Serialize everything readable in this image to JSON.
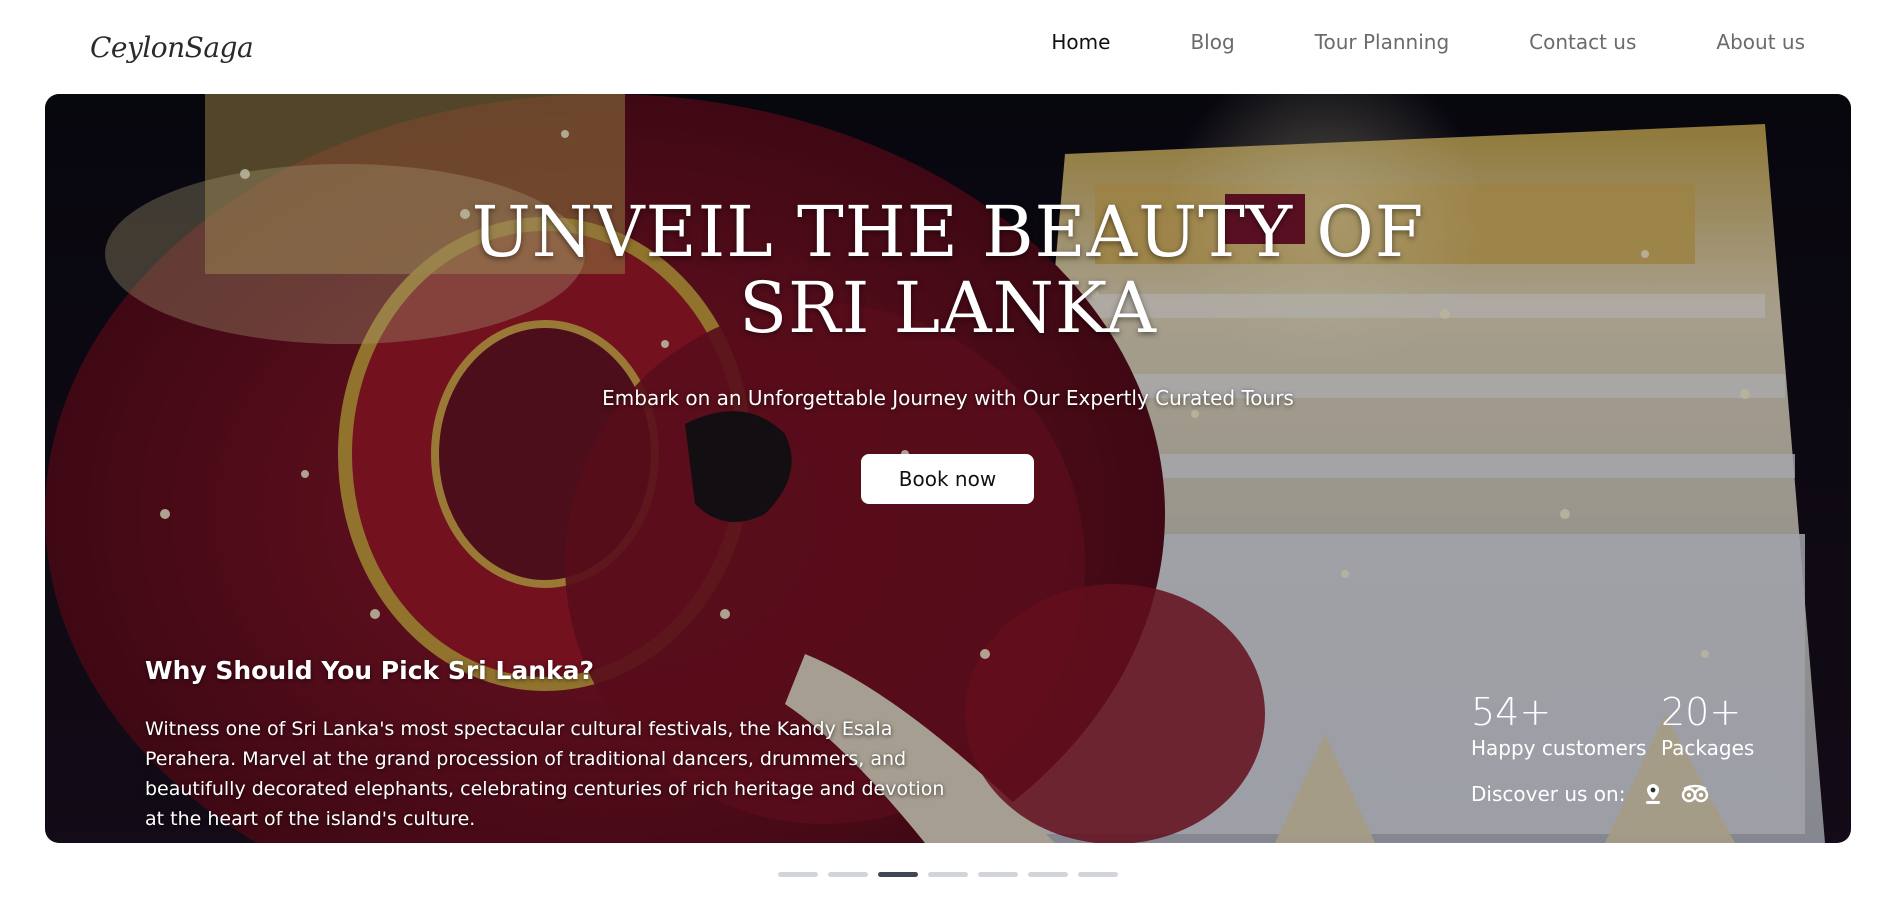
{
  "brand": {
    "logo_text": "CeylonSaga"
  },
  "nav": {
    "items": [
      {
        "label": "Home",
        "active": true
      },
      {
        "label": "Blog",
        "active": false
      },
      {
        "label": "Tour Planning",
        "active": false
      },
      {
        "label": "Contact us",
        "active": false
      },
      {
        "label": "About us",
        "active": false
      }
    ]
  },
  "hero": {
    "title_line1": "UNVEIL THE BEAUTY OF",
    "title_line2": "SRI LANKA",
    "subtitle": "Embark on an Unforgettable Journey with Our Expertly Curated Tours",
    "cta_label": "Book now",
    "why_title": "Why Should You Pick Sri Lanka?",
    "why_body": "Witness one of Sri Lanka's most spectacular cultural festivals, the Kandy Esala Perahera. Marvel at the grand procession of traditional dancers, drummers, and beautifully decorated elephants, celebrating centuries of rich heritage and devotion at the heart of the island's culture."
  },
  "stats": {
    "customers_value": "54+",
    "customers_label": "Happy customers",
    "packages_value": "20+",
    "packages_label": "Packages"
  },
  "discover": {
    "label": "Discover us on:",
    "icons": [
      "map-pin-icon",
      "tripadvisor-icon"
    ]
  },
  "carousel": {
    "total_slides": 7,
    "active_index": 2
  },
  "colors": {
    "active_dot": "#3f4654",
    "inactive_dot": "#d1d5db",
    "nav_active": "#111111",
    "nav_inactive": "#6b6b6b"
  }
}
